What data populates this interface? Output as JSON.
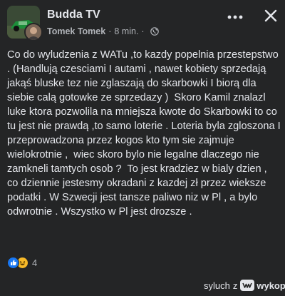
{
  "header": {
    "group_name": "Budda TV",
    "author": "Tomek Tomek",
    "separator": "·",
    "time": "8 min."
  },
  "icons": {
    "visibility": "globe-icon",
    "more": "more-options-icon",
    "close": "close-icon"
  },
  "post": {
    "paragraphs": [
      "Co do wyludzenia z WATu ,to kazdy popelnia przestepstwo . (Handlują czesciami I autami , nawet kobiety sprzedają jakąś bluske tez nie zglaszają do skarbowki I biorą dla siebie calą gotowke ze sprzedazy )  Skoro Kamil znalazl luke ktora pozwolila na mniejsza kwote do Skarbowki to co tu jest nie prawdą ,to samo loterie . Loteria byla zgloszona I przeprowadzona przez kogos kto tym sie zajmuje wielokrotnie ,  wiec skoro bylo nie legalne dlaczego nie zamkneli tamtych osob ?  To jest kradziez w bialy dzien , co dziennie jestesmy okradani z kazdej zł przez wieksze podatki . W Szwecji jest tansze paliwo niz w Pl , a bylo odwrotnie . Wszystko w Pl jest drozsze ."
    ]
  },
  "reactions": {
    "types": [
      "like-icon",
      "haha-icon"
    ],
    "count": "4"
  },
  "watermark": {
    "user": "syluch",
    "z": "z",
    "site": "wykop.pl"
  },
  "colors": {
    "background": "#242526",
    "text": "#e4e6eb",
    "secondary": "#b0b3b8",
    "like_blue": "#1877f2",
    "haha_yellow": "#f7b928"
  }
}
